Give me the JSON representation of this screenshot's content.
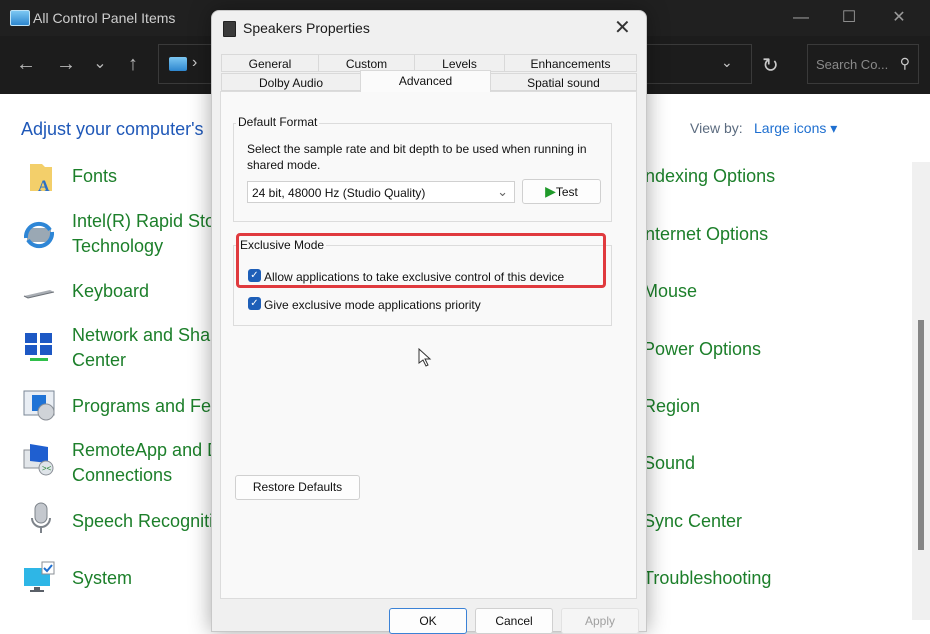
{
  "explorer": {
    "window_title": "All Control Panel Items",
    "window_controls": {
      "minimize": "—",
      "maximize": "☐",
      "close": "✕"
    },
    "nav": {
      "back": "←",
      "forward": "→",
      "recent": "⌄",
      "up": "↑",
      "breadcrumb_sep": "›",
      "address_dropdown": "⌄",
      "refresh": "↻"
    },
    "search": {
      "placeholder": "Search Co...",
      "icon": "⚲"
    },
    "heading": "Adjust your computer's",
    "view_by_label": "View by:",
    "view_by_value": "Large icons ▾",
    "items_left": [
      {
        "label": "Fonts",
        "icon": "fonts-icon"
      },
      {
        "label": "Intel(R) Rapid Sto\nTechnology",
        "line1": "Intel(R) Rapid Sto",
        "line2": "Technology",
        "icon": "storage-icon"
      },
      {
        "label": "Keyboard",
        "icon": "keyboard-icon"
      },
      {
        "line1": "Network and Shar",
        "line2": "Center",
        "icon": "network-icon"
      },
      {
        "label": "Programs and Fea",
        "icon": "programs-icon"
      },
      {
        "line1": "RemoteApp and D",
        "line2": "Connections",
        "icon": "remoteapp-icon"
      },
      {
        "label": "Speech Recogniti",
        "icon": "microphone-icon"
      },
      {
        "label": "System",
        "icon": "system-icon"
      }
    ],
    "items_right": [
      {
        "label": "ndexing Options"
      },
      {
        "label": "nternet Options"
      },
      {
        "label": "Mouse"
      },
      {
        "label": "Power Options"
      },
      {
        "label": "Region"
      },
      {
        "label": "Sound"
      },
      {
        "label": "Sync Center"
      },
      {
        "label": "Troubleshooting"
      }
    ]
  },
  "dialog": {
    "title": "Speakers Properties",
    "close": "✕",
    "tabs_row1": [
      "General",
      "Custom",
      "Levels",
      "Enhancements"
    ],
    "tabs_row2": [
      "Dolby Audio",
      "Advanced",
      "Spatial sound"
    ],
    "active_tab": "Advanced",
    "default_format": {
      "label": "Default Format",
      "description": "Select the sample rate and bit depth to be used when running in shared mode.",
      "selected": "24 bit, 48000 Hz (Studio Quality)",
      "dropdown_icon": "⌄",
      "test_label": "Test",
      "test_icon": "▶"
    },
    "exclusive_mode": {
      "label": "Exclusive Mode",
      "options": [
        {
          "label": "Allow applications to take exclusive control of this device",
          "checked": true
        },
        {
          "label": "Give exclusive mode applications priority",
          "checked": true
        }
      ],
      "check_glyph": "✓"
    },
    "restore_defaults": "Restore Defaults",
    "buttons": {
      "ok": "OK",
      "cancel": "Cancel",
      "apply": "Apply"
    }
  },
  "colors": {
    "link_green": "#1c7f2a",
    "heading_blue": "#1f58b8",
    "highlight_red": "#e03a3e",
    "checkbox_blue": "#1e5fb8"
  }
}
